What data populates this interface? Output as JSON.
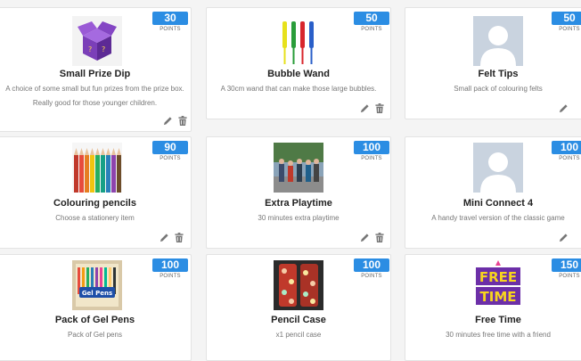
{
  "points_label": "POINTS",
  "colors": {
    "badge": "#2b8de3",
    "icon": "#777777"
  },
  "rewards": [
    {
      "title": "Small Prize Dip",
      "points": "30",
      "description": "A choice of some small but fun prizes from the prize box. Really good for those younger children.",
      "image": "prize-box-image"
    },
    {
      "title": "Bubble Wand",
      "points": "50",
      "description": "A 30cm wand that can make those large bubbles.",
      "image": "bubble-wand-image"
    },
    {
      "title": "Felt Tips",
      "points": "50",
      "description": "Small pack of colouring felts",
      "image": "placeholder-avatar-image"
    },
    {
      "title": "Colouring pencils",
      "points": "90",
      "description": "Choose a stationery item",
      "image": "colouring-pencils-image"
    },
    {
      "title": "Extra Playtime",
      "points": "100",
      "description": "30 minutes extra playtime",
      "image": "playground-photo-image"
    },
    {
      "title": "Mini Connect 4",
      "points": "100",
      "description": "A handy travel version of the classic game",
      "image": "placeholder-avatar-image"
    },
    {
      "title": "Pack of Gel Pens",
      "points": "100",
      "description": "Pack of Gel pens",
      "image": "gel-pens-image"
    },
    {
      "title": "Pencil Case",
      "points": "100",
      "description": "x1 pencil case",
      "image": "pencil-case-image"
    },
    {
      "title": "Free Time",
      "points": "150",
      "description": "30 minutes free time with a friend",
      "image": "free-time-image"
    }
  ]
}
